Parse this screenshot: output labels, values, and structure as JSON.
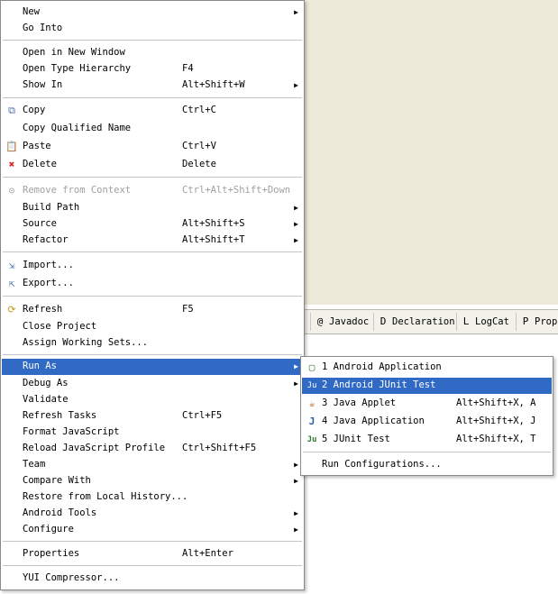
{
  "view_tabs": [
    {
      "label": "Javadoc",
      "icon": "@"
    },
    {
      "label": "Declaration",
      "icon": "D"
    },
    {
      "label": "LogCat",
      "icon": "L"
    },
    {
      "label": "Prop",
      "icon": "P"
    }
  ],
  "context_menu": {
    "items": [
      {
        "label": "New"
      },
      {
        "label": "Go Into"
      },
      {
        "label": "Open in New Window"
      },
      {
        "label": "Open Type Hierarchy",
        "shortcut": "F4"
      },
      {
        "label": "Show In",
        "shortcut": "Alt+Shift+W"
      },
      {
        "label": "Copy",
        "shortcut": "Ctrl+C"
      },
      {
        "label": "Copy Qualified Name"
      },
      {
        "label": "Paste",
        "shortcut": "Ctrl+V"
      },
      {
        "label": "Delete",
        "shortcut": "Delete"
      },
      {
        "label": "Remove from Context",
        "shortcut": "Ctrl+Alt+Shift+Down"
      },
      {
        "label": "Build Path"
      },
      {
        "label": "Source",
        "shortcut": "Alt+Shift+S"
      },
      {
        "label": "Refactor",
        "shortcut": "Alt+Shift+T"
      },
      {
        "label": "Import..."
      },
      {
        "label": "Export..."
      },
      {
        "label": "Refresh",
        "shortcut": "F5"
      },
      {
        "label": "Close Project"
      },
      {
        "label": "Assign Working Sets..."
      },
      {
        "label": "Run As"
      },
      {
        "label": "Debug As"
      },
      {
        "label": "Validate"
      },
      {
        "label": "Refresh Tasks",
        "shortcut": "Ctrl+F5"
      },
      {
        "label": "Format JavaScript"
      },
      {
        "label": "Reload JavaScript Profile",
        "shortcut": "Ctrl+Shift+F5"
      },
      {
        "label": "Team"
      },
      {
        "label": "Compare With"
      },
      {
        "label": "Restore from Local History..."
      },
      {
        "label": "Android Tools"
      },
      {
        "label": "Configure"
      },
      {
        "label": "Properties",
        "shortcut": "Alt+Enter"
      },
      {
        "label": "YUI Compressor..."
      }
    ]
  },
  "run_as_menu": {
    "items": [
      {
        "label": "1 Android Application"
      },
      {
        "label": "2 Android JUnit Test"
      },
      {
        "label": "3 Java Applet",
        "shortcut": "Alt+Shift+X, A"
      },
      {
        "label": "4 Java Application",
        "shortcut": "Alt+Shift+X, J"
      },
      {
        "label": "5 JUnit Test",
        "shortcut": "Alt+Shift+X, T"
      },
      {
        "label": "Run Configurations..."
      }
    ]
  },
  "icons": {
    "submenu_arrow": "▶",
    "copy": "⧉",
    "paste": "📋",
    "delete": "✖",
    "remove": "⊝",
    "import": "⇲",
    "export": "⇱",
    "refresh": "⟳",
    "android_app": "▢",
    "junit_android": "Ju",
    "applet": "☕",
    "java_app": "J",
    "junit": "Ju"
  },
  "colors": {
    "selection": "#316ac5",
    "delete_icon": "#d92b2b",
    "editor_bg": "#ece9d8"
  }
}
